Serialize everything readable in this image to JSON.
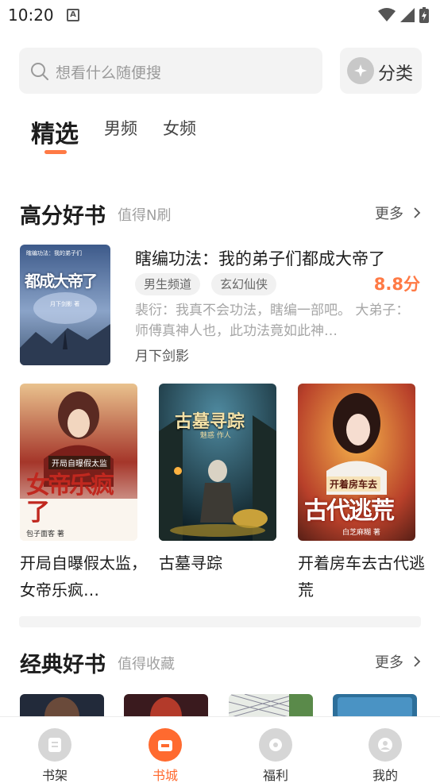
{
  "status_bar": {
    "time": "10:20",
    "notif_icon": "A"
  },
  "search": {
    "placeholder": "想看什么随便搜"
  },
  "category_button": {
    "label": "分类"
  },
  "tabs": [
    {
      "label": "精选",
      "active": true
    },
    {
      "label": "男频",
      "active": false
    },
    {
      "label": "女频",
      "active": false
    }
  ],
  "section_high": {
    "title": "高分好书",
    "subtitle": "值得N刷",
    "more": "更多",
    "featured": {
      "title": "瞎编功法：我的弟子们都成大帝了",
      "tags": [
        "男生频道",
        "玄幻仙侠"
      ],
      "score": "8.8分",
      "description": "裴衍：我真不会功法，瞎编一部吧。 大弟子：师傅真神人也，此功法竟如此神…",
      "author": "月下剑影",
      "cover_text": "都成大帝了",
      "cover_small": "瞎编功法：我的弟子们",
      "cover_author": "月下剑影 著"
    },
    "books": [
      {
        "title": "开局自曝假太监，女帝乐疯…",
        "cover_text": "女帝乐疯了",
        "cover_small": "开局自曝假太监",
        "cover_author": "包子面客 著"
      },
      {
        "title": "古墓寻踪",
        "cover_text": "古墓寻踪",
        "cover_small": "魅惑 作人",
        "cover_author": ""
      },
      {
        "title": "开着房车去古代逃荒",
        "cover_text": "古代逃荒",
        "cover_small": "开着房车去",
        "cover_author": "白芝麻糊 著"
      }
    ]
  },
  "section_classic": {
    "title": "经典好书",
    "subtitle": "值得收藏",
    "more": "更多"
  },
  "bottom_nav": [
    {
      "label": "书架",
      "icon": "bookshelf-icon",
      "active": false
    },
    {
      "label": "书城",
      "icon": "bookstore-icon",
      "active": true
    },
    {
      "label": "福利",
      "icon": "gift-icon",
      "active": false
    },
    {
      "label": "我的",
      "icon": "profile-icon",
      "active": false
    }
  ],
  "colors": {
    "accent": "#ff7a45",
    "nav_active": "#ff6a2f"
  }
}
